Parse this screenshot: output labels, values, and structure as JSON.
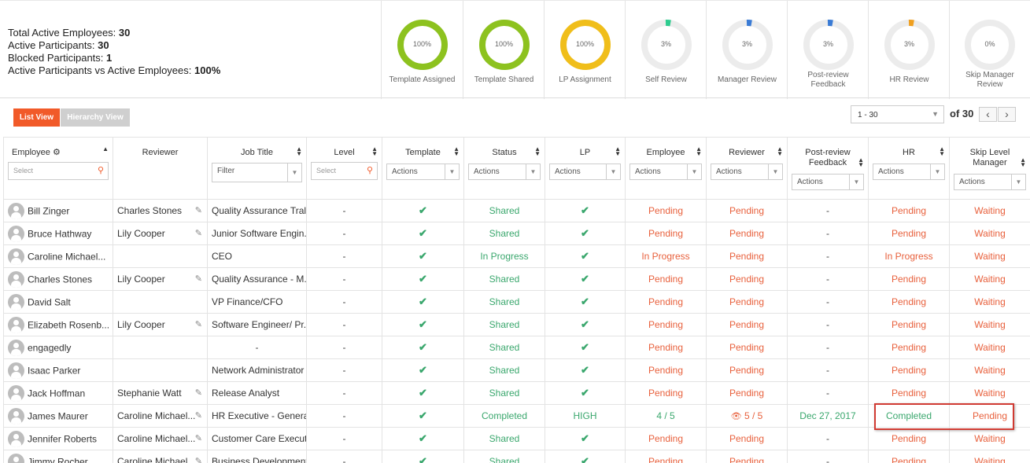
{
  "summary": {
    "total_active_label": "Total Active Employees:",
    "total_active_value": "30",
    "active_participants_label": "Active Participants:",
    "active_participants_value": "30",
    "blocked_label": "Blocked Participants:",
    "blocked_value": "1",
    "ratio_label": "Active Participants vs Active Employees:",
    "ratio_value": "100%"
  },
  "metrics": [
    {
      "label": "Template Assigned",
      "pct_text": "100%",
      "pct": 100,
      "color": "#8dc21f"
    },
    {
      "label": "Template Shared",
      "pct_text": "100%",
      "pct": 100,
      "color": "#8dc21f"
    },
    {
      "label": "LP Assignment",
      "pct_text": "100%",
      "pct": 100,
      "color": "#f0be1a"
    },
    {
      "label": "Self Review",
      "pct_text": "3%",
      "pct": 3,
      "color": "#2ecc8f"
    },
    {
      "label": "Manager Review",
      "pct_text": "3%",
      "pct": 3,
      "color": "#3a7bd5"
    },
    {
      "label": "Post-review Feedback",
      "pct_text": "3%",
      "pct": 3,
      "color": "#3a7bd5"
    },
    {
      "label": "HR Review",
      "pct_text": "3%",
      "pct": 3,
      "color": "#f0a020"
    },
    {
      "label": "Skip Manager Review",
      "pct_text": "0%",
      "pct": 0,
      "color": "#cccccc"
    }
  ],
  "toolbar": {
    "list_view": "List View",
    "hierarchy_view": "Hierarchy View",
    "page_range": "1 - 30",
    "of_total": "of 30",
    "prev": "‹",
    "next": "›"
  },
  "columns": {
    "employee": "Employee",
    "reviewer": "Reviewer",
    "job_title": "Job Title",
    "level": "Level",
    "template": "Template",
    "status": "Status",
    "lp": "LP",
    "employee_review": "Employee",
    "reviewer_review": "Reviewer",
    "post_review": "Post-review Feedback",
    "hr": "HR",
    "skip_level": "Skip Level Manager"
  },
  "filters": {
    "select_placeholder": "Select",
    "filter_label": "Filter",
    "actions_label": "Actions"
  },
  "rows": [
    {
      "employee": "Bill Zinger",
      "reviewer": "Charles Stones",
      "job": "Quality Assurance Tral...",
      "level": "-",
      "status": "Shared",
      "status_cls": "g",
      "lp": "check",
      "emp": "Pending",
      "rev": "Pending",
      "post": "-",
      "hr": "Pending",
      "hr_cls": "o",
      "skip": "Waiting"
    },
    {
      "employee": "Bruce Hathway",
      "reviewer": "Lily Cooper",
      "job": "Junior Software Engin...",
      "level": "-",
      "status": "Shared",
      "status_cls": "g",
      "lp": "check",
      "emp": "Pending",
      "rev": "Pending",
      "post": "-",
      "hr": "Pending",
      "hr_cls": "o",
      "skip": "Waiting"
    },
    {
      "employee": "Caroline Michael...",
      "reviewer": "",
      "job": "CEO",
      "level": "-",
      "status": "In Progress",
      "status_cls": "g",
      "lp": "check",
      "emp": "In Progress",
      "rev": "Pending",
      "post": "-",
      "hr": "In Progress",
      "hr_cls": "o",
      "skip": "Waiting"
    },
    {
      "employee": "Charles Stones",
      "reviewer": "Lily Cooper",
      "job": "Quality Assurance - M...",
      "level": "-",
      "status": "Shared",
      "status_cls": "g",
      "lp": "check",
      "emp": "Pending",
      "rev": "Pending",
      "post": "-",
      "hr": "Pending",
      "hr_cls": "o",
      "skip": "Waiting"
    },
    {
      "employee": "David Salt",
      "reviewer": "",
      "job": "VP Finance/CFO",
      "level": "-",
      "status": "Shared",
      "status_cls": "g",
      "lp": "check",
      "emp": "Pending",
      "rev": "Pending",
      "post": "-",
      "hr": "Pending",
      "hr_cls": "o",
      "skip": "Waiting"
    },
    {
      "employee": "Elizabeth Rosenb...",
      "reviewer": "Lily Cooper",
      "job": "Software Engineer/ Pr...",
      "level": "-",
      "status": "Shared",
      "status_cls": "g",
      "lp": "check",
      "emp": "Pending",
      "rev": "Pending",
      "post": "-",
      "hr": "Pending",
      "hr_cls": "o",
      "skip": "Waiting"
    },
    {
      "employee": "engagedly",
      "reviewer": "",
      "job": "-",
      "level": "-",
      "status": "Shared",
      "status_cls": "g",
      "lp": "check",
      "emp": "Pending",
      "rev": "Pending",
      "post": "-",
      "hr": "Pending",
      "hr_cls": "o",
      "skip": "Waiting"
    },
    {
      "employee": "Isaac Parker",
      "reviewer": "",
      "job": "Network Administrator",
      "level": "-",
      "status": "Shared",
      "status_cls": "g",
      "lp": "check",
      "emp": "Pending",
      "rev": "Pending",
      "post": "-",
      "hr": "Pending",
      "hr_cls": "o",
      "skip": "Waiting"
    },
    {
      "employee": "Jack Hoffman",
      "reviewer": "Stephanie Watt",
      "job": "Release Analyst",
      "level": "-",
      "status": "Shared",
      "status_cls": "g",
      "lp": "check",
      "emp": "Pending",
      "rev": "Pending",
      "post": "-",
      "hr": "Pending",
      "hr_cls": "o",
      "skip": "Waiting"
    },
    {
      "employee": "James Maurer",
      "reviewer": "Caroline Michael...",
      "job": "HR Executive - Genera...",
      "level": "-",
      "status": "Completed",
      "status_cls": "g",
      "lp": "HIGH",
      "emp": "4 / 5",
      "emp_cls": "g",
      "rev": "5 / 5",
      "rev_eye": true,
      "post": "Dec 27, 2017",
      "post_cls": "g",
      "hr": "Completed",
      "hr_cls": "g",
      "skip": "Pending"
    },
    {
      "employee": "Jennifer Roberts",
      "reviewer": "Caroline Michael...",
      "job": "Customer Care Execut...",
      "level": "-",
      "status": "Shared",
      "status_cls": "g",
      "lp": "check",
      "emp": "Pending",
      "rev": "Pending",
      "post": "-",
      "hr": "Pending",
      "hr_cls": "o",
      "skip": "Waiting"
    },
    {
      "employee": "Jimmy Rocher",
      "reviewer": "Caroline Michael...",
      "job": "Business Development...",
      "level": "-",
      "status": "Shared",
      "status_cls": "g",
      "lp": "check",
      "emp": "Pending",
      "rev": "Pending",
      "post": "-",
      "hr": "Pending",
      "hr_cls": "o",
      "skip": "Waiting"
    }
  ]
}
